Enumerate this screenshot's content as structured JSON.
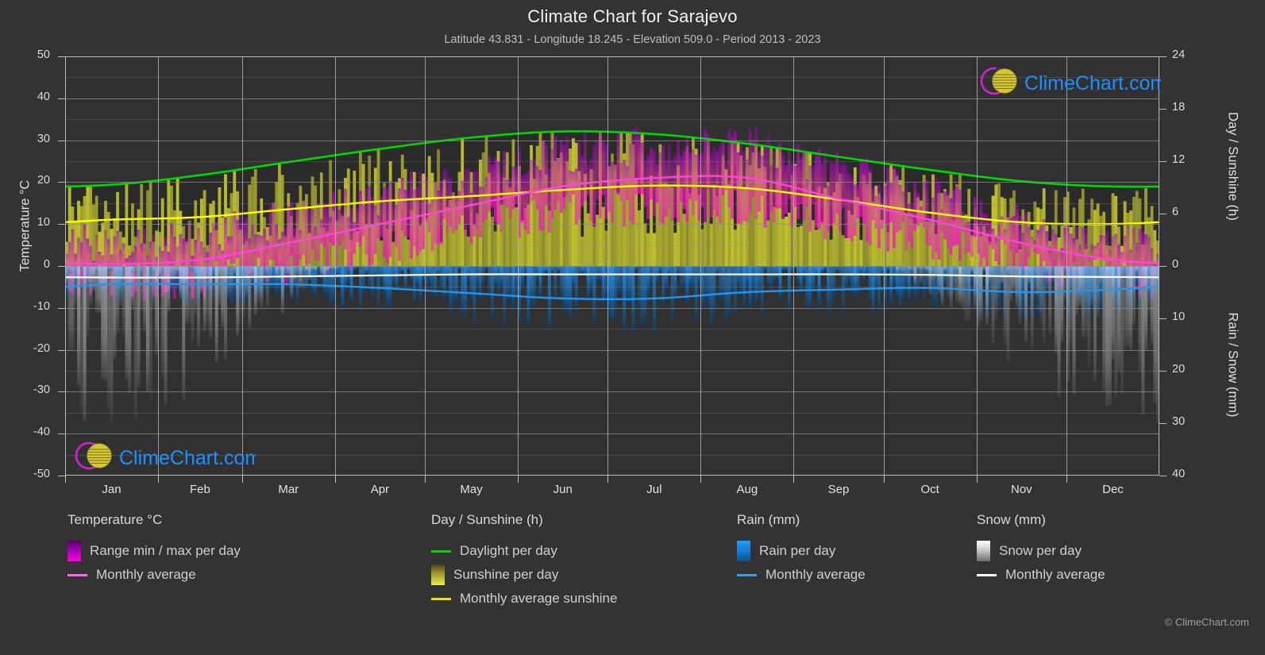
{
  "header": {
    "title": "Climate Chart for Sarajevo",
    "subtitle": "Latitude 43.831 - Longitude 18.245 - Elevation 509.0 - Period 2013 - 2023"
  },
  "axes": {
    "left_title": "Temperature °C",
    "right_title_top": "Day / Sunshine (h)",
    "right_title_bottom": "Rain / Snow (mm)",
    "left_ticks": [
      "50",
      "40",
      "30",
      "20",
      "10",
      "0",
      "-10",
      "-20",
      "-30",
      "-40",
      "-50"
    ],
    "right_ticks_top": [
      "24",
      "18",
      "12",
      "6",
      "0"
    ],
    "right_ticks_bottom": [
      "10",
      "20",
      "30",
      "40"
    ],
    "x_ticks": [
      "Jan",
      "Feb",
      "Mar",
      "Apr",
      "May",
      "Jun",
      "Jul",
      "Aug",
      "Sep",
      "Oct",
      "Nov",
      "Dec"
    ]
  },
  "legend": {
    "temperature": {
      "heading": "Temperature °C",
      "items": [
        {
          "label": "Range min / max per day",
          "type": "swatch",
          "color": "#ff00e0"
        },
        {
          "label": "Monthly average",
          "type": "line",
          "color": "#ff66ee"
        }
      ]
    },
    "sunshine": {
      "heading": "Day / Sunshine (h)",
      "items": [
        {
          "label": "Daylight per day",
          "type": "line",
          "color": "#00d900"
        },
        {
          "label": "Sunshine per day",
          "type": "swatch",
          "color": "#e8e83a"
        },
        {
          "label": "Monthly average sunshine",
          "type": "line",
          "color": "#e6e600"
        }
      ]
    },
    "rain": {
      "heading": "Rain (mm)",
      "items": [
        {
          "label": "Rain per day",
          "type": "swatch",
          "color": "#1e90ff"
        },
        {
          "label": "Monthly average",
          "type": "line",
          "color": "#33a0ee"
        }
      ]
    },
    "snow": {
      "heading": "Snow (mm)",
      "items": [
        {
          "label": "Snow per day",
          "type": "swatch",
          "color": "#f2f2f2"
        },
        {
          "label": "Monthly average",
          "type": "line",
          "color": "#ffffff"
        }
      ]
    }
  },
  "branding": {
    "name": "ClimeChart.com",
    "copyright": "© ClimeChart.com",
    "text_color": "#1e90ff",
    "ring_color": "#cc22cc",
    "sun_color": "#d4c832"
  },
  "colors": {
    "background": "#333333",
    "plot_background": "#313131",
    "grid": "#8c8c8c",
    "axis": "#b9b9b9",
    "text": "#d6d6d6",
    "daylight": "#00d900",
    "sunshine_avg": "#ffff00",
    "temp_avg": "#ff44dd",
    "rain_avg": "#2196f3",
    "snow_avg": "#ffffff"
  },
  "chart_data": {
    "type": "area",
    "title": "Climate Chart for Sarajevo",
    "subtitle": "Latitude 43.831 - Longitude 18.245 - Elevation 509.0 - Period 2013 - 2023",
    "xlabel": "",
    "ylabel": "Temperature °C",
    "y2label_top": "Day / Sunshine (h)",
    "y2label_bottom": "Rain / Snow (mm)",
    "ylim": [
      -50,
      50
    ],
    "y2lim_top": [
      0,
      24
    ],
    "y2lim_bottom": [
      0,
      40
    ],
    "grid": true,
    "legend_position": "below",
    "categories": [
      "Jan",
      "Feb",
      "Mar",
      "Apr",
      "May",
      "Jun",
      "Jul",
      "Aug",
      "Sep",
      "Oct",
      "Nov",
      "Dec"
    ],
    "series": [
      {
        "name": "Daylight per day",
        "unit": "h",
        "axis": "right-top",
        "color": "#00d900",
        "values": [
          9.3,
          10.4,
          11.9,
          13.4,
          14.7,
          15.4,
          15.1,
          14.0,
          12.5,
          11.0,
          9.7,
          9.1
        ]
      },
      {
        "name": "Monthly average sunshine",
        "unit": "h",
        "axis": "right-top",
        "color": "#ffff00",
        "values": [
          5.3,
          5.6,
          6.5,
          7.4,
          8.0,
          8.7,
          9.2,
          8.9,
          7.6,
          6.1,
          5.0,
          4.8
        ]
      },
      {
        "name": "Monthly average temperature",
        "unit": "°C",
        "axis": "left",
        "color": "#ff44dd",
        "values": [
          0.5,
          1.5,
          5.5,
          10.0,
          14.5,
          19.0,
          21.0,
          21.0,
          16.0,
          11.0,
          5.5,
          1.5
        ]
      },
      {
        "name": "Monthly average rain",
        "unit": "mm",
        "axis": "right-bottom",
        "color": "#2196f3",
        "values": [
          3.5,
          3.5,
          3.5,
          4.2,
          5.2,
          6.2,
          6.2,
          5.0,
          4.5,
          4.2,
          5.0,
          4.5
        ]
      },
      {
        "name": "Monthly average snow",
        "unit": "mm",
        "axis": "right-bottom",
        "color": "#ffffff",
        "values": [
          2.2,
          2.2,
          2.0,
          1.8,
          1.6,
          1.6,
          1.6,
          1.6,
          1.6,
          1.7,
          2.0,
          2.1
        ]
      },
      {
        "name": "Temperature range min per day",
        "unit": "°C",
        "axis": "left",
        "color": "#8a00a8",
        "values": [
          -3.5,
          -3.0,
          0.5,
          4.5,
          9.0,
          13.0,
          14.5,
          14.5,
          10.5,
          6.0,
          1.5,
          -2.5
        ]
      },
      {
        "name": "Temperature range max per day",
        "unit": "°C",
        "axis": "left",
        "color": "#ff00e0",
        "values": [
          5.0,
          6.5,
          11.0,
          16.0,
          21.0,
          26.0,
          28.5,
          28.5,
          22.5,
          16.5,
          9.5,
          5.5
        ]
      }
    ]
  }
}
